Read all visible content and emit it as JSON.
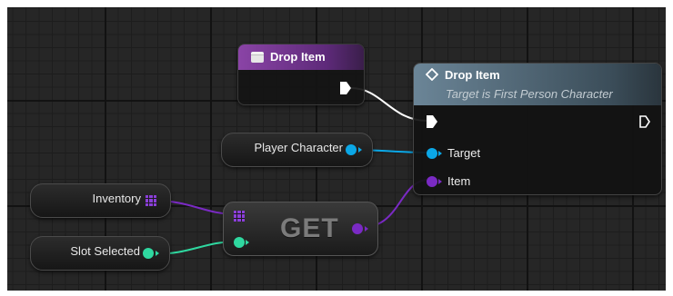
{
  "graph": {
    "event_node": {
      "title": "Drop Item"
    },
    "function_node": {
      "title": "Drop Item",
      "subtitle": "Target is First Person Character",
      "pins": {
        "target": "Target",
        "item": "Item"
      }
    },
    "variables": {
      "player_character": "Player Character",
      "inventory": "Inventory",
      "slot_selected": "Slot Selected"
    },
    "get_node": {
      "label": "GET"
    }
  },
  "colors": {
    "event_header": "#7d3c98",
    "function_header": "#6f8898",
    "object_pin": "#0ba7e6",
    "array_pin": "#8b3fd9",
    "int_pin": "#2fd8a0",
    "exec_pin": "#ffffff"
  },
  "icons": {
    "event": "event-icon",
    "function": "function-icon"
  }
}
